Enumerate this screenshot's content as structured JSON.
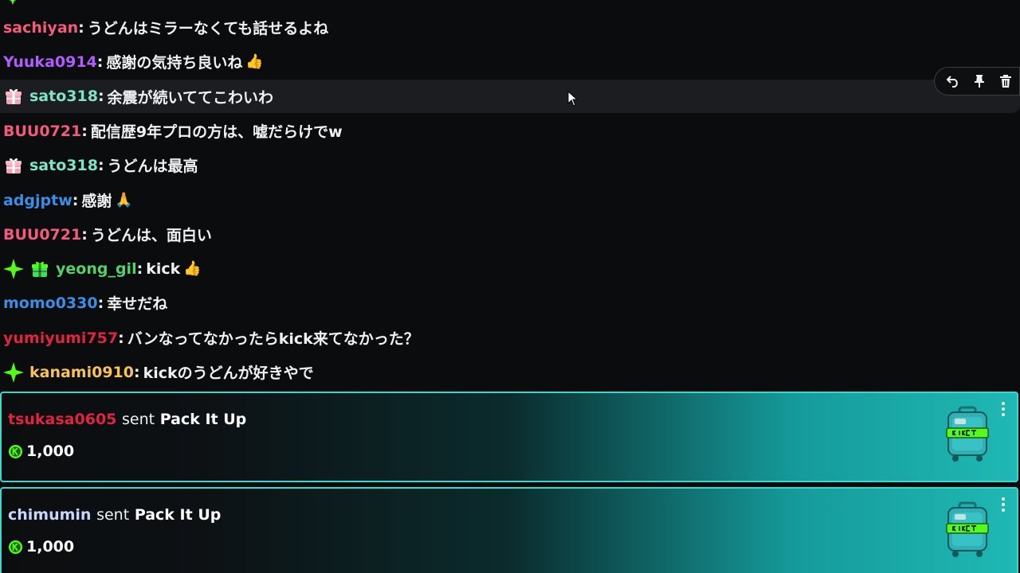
{
  "colors": {
    "background": "#0b0c0d",
    "hover_row": "#1b1d20",
    "card_border": "#3ed6c8",
    "kick_green": "#53fc18"
  },
  "messages": [
    {
      "user": "sachiyan",
      "color": "#f35a7b",
      "text": "うどんはミラーなくても話せるよね",
      "emoji": "",
      "badges": []
    },
    {
      "user": "Yuuka0914",
      "color": "#b05cff",
      "text": "感謝の気持ち良いね",
      "emoji": "👍",
      "badges": []
    },
    {
      "user": "sato318",
      "color": "#7fe4c7",
      "text": "余震が続いててこわいわ",
      "emoji": "",
      "badges": [
        "gift-icon-pink"
      ]
    },
    {
      "user": "BUU0721",
      "color": "#f35a7b",
      "text": "配信歴9年プロの方は、嘘だらけでw",
      "emoji": "",
      "badges": []
    },
    {
      "user": "sato318",
      "color": "#7fe4c7",
      "text": "うどんは最高",
      "emoji": "",
      "badges": [
        "gift-icon-pink"
      ]
    },
    {
      "user": "adgjptw",
      "color": "#3a8ee6",
      "text": "感謝",
      "emoji": "🙏",
      "badges": []
    },
    {
      "user": "BUU0721",
      "color": "#f35a7b",
      "text": "うどんは、面白い",
      "emoji": "",
      "badges": []
    },
    {
      "user": "yeong_gil",
      "color": "#53d16b",
      "text": "kick",
      "emoji": "👍",
      "badges": [
        "sparkle-icon",
        "gift-icon-green"
      ]
    },
    {
      "user": "momo0330",
      "color": "#3a8ee6",
      "text": "幸せだね",
      "emoji": "",
      "badges": []
    },
    {
      "user": "yumiyumi757",
      "color": "#e0233f",
      "text": "バンなってなかったらkick来てなかった？",
      "emoji": "",
      "badges": []
    },
    {
      "user": "kanami0910",
      "color": "#f7c15b",
      "text": "kickのうどんが好きやで",
      "emoji": "",
      "badges": [
        "sparkle-icon"
      ]
    }
  ],
  "gifts": [
    {
      "user": "tsukasa0605",
      "color": "#e0233f",
      "sent": "sent",
      "gift": "Pack It Up",
      "amount": "1,000"
    },
    {
      "user": "chimumin",
      "color": "#c9d6ff",
      "sent": "sent",
      "gift": "Pack It Up",
      "amount": "1,000"
    }
  ],
  "separator": ":",
  "actions": [
    "reply-icon",
    "pin-icon",
    "delete-icon"
  ]
}
